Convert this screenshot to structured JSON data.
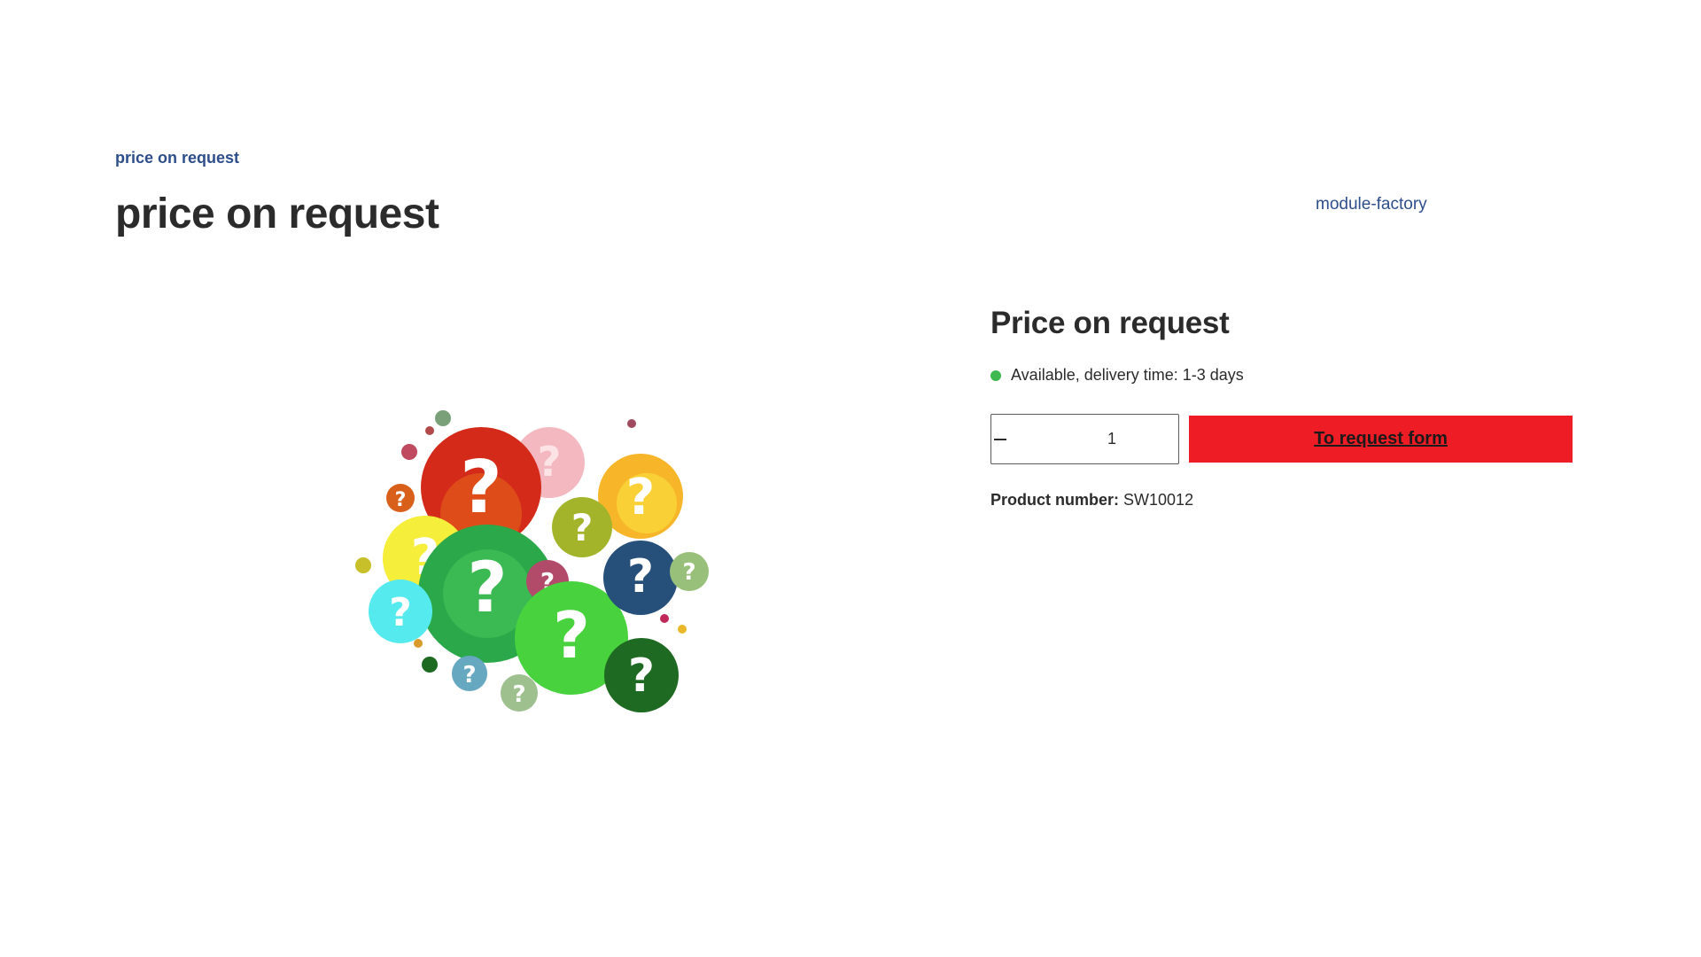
{
  "breadcrumb": {
    "label": "price on request"
  },
  "page_title": "price on request",
  "manufacturer": {
    "label": "module-factory"
  },
  "product_image": {
    "icon": "question-marks-image"
  },
  "buy_box": {
    "price": "Price on request",
    "delivery": "Available, delivery time: 1-3 days",
    "availability_color": "#3fb94f",
    "quantity": "1",
    "request_button": "To request form",
    "request_button_color": "#ee1c25",
    "product_number_label": "Product number:",
    "product_number_value": "SW10012"
  }
}
